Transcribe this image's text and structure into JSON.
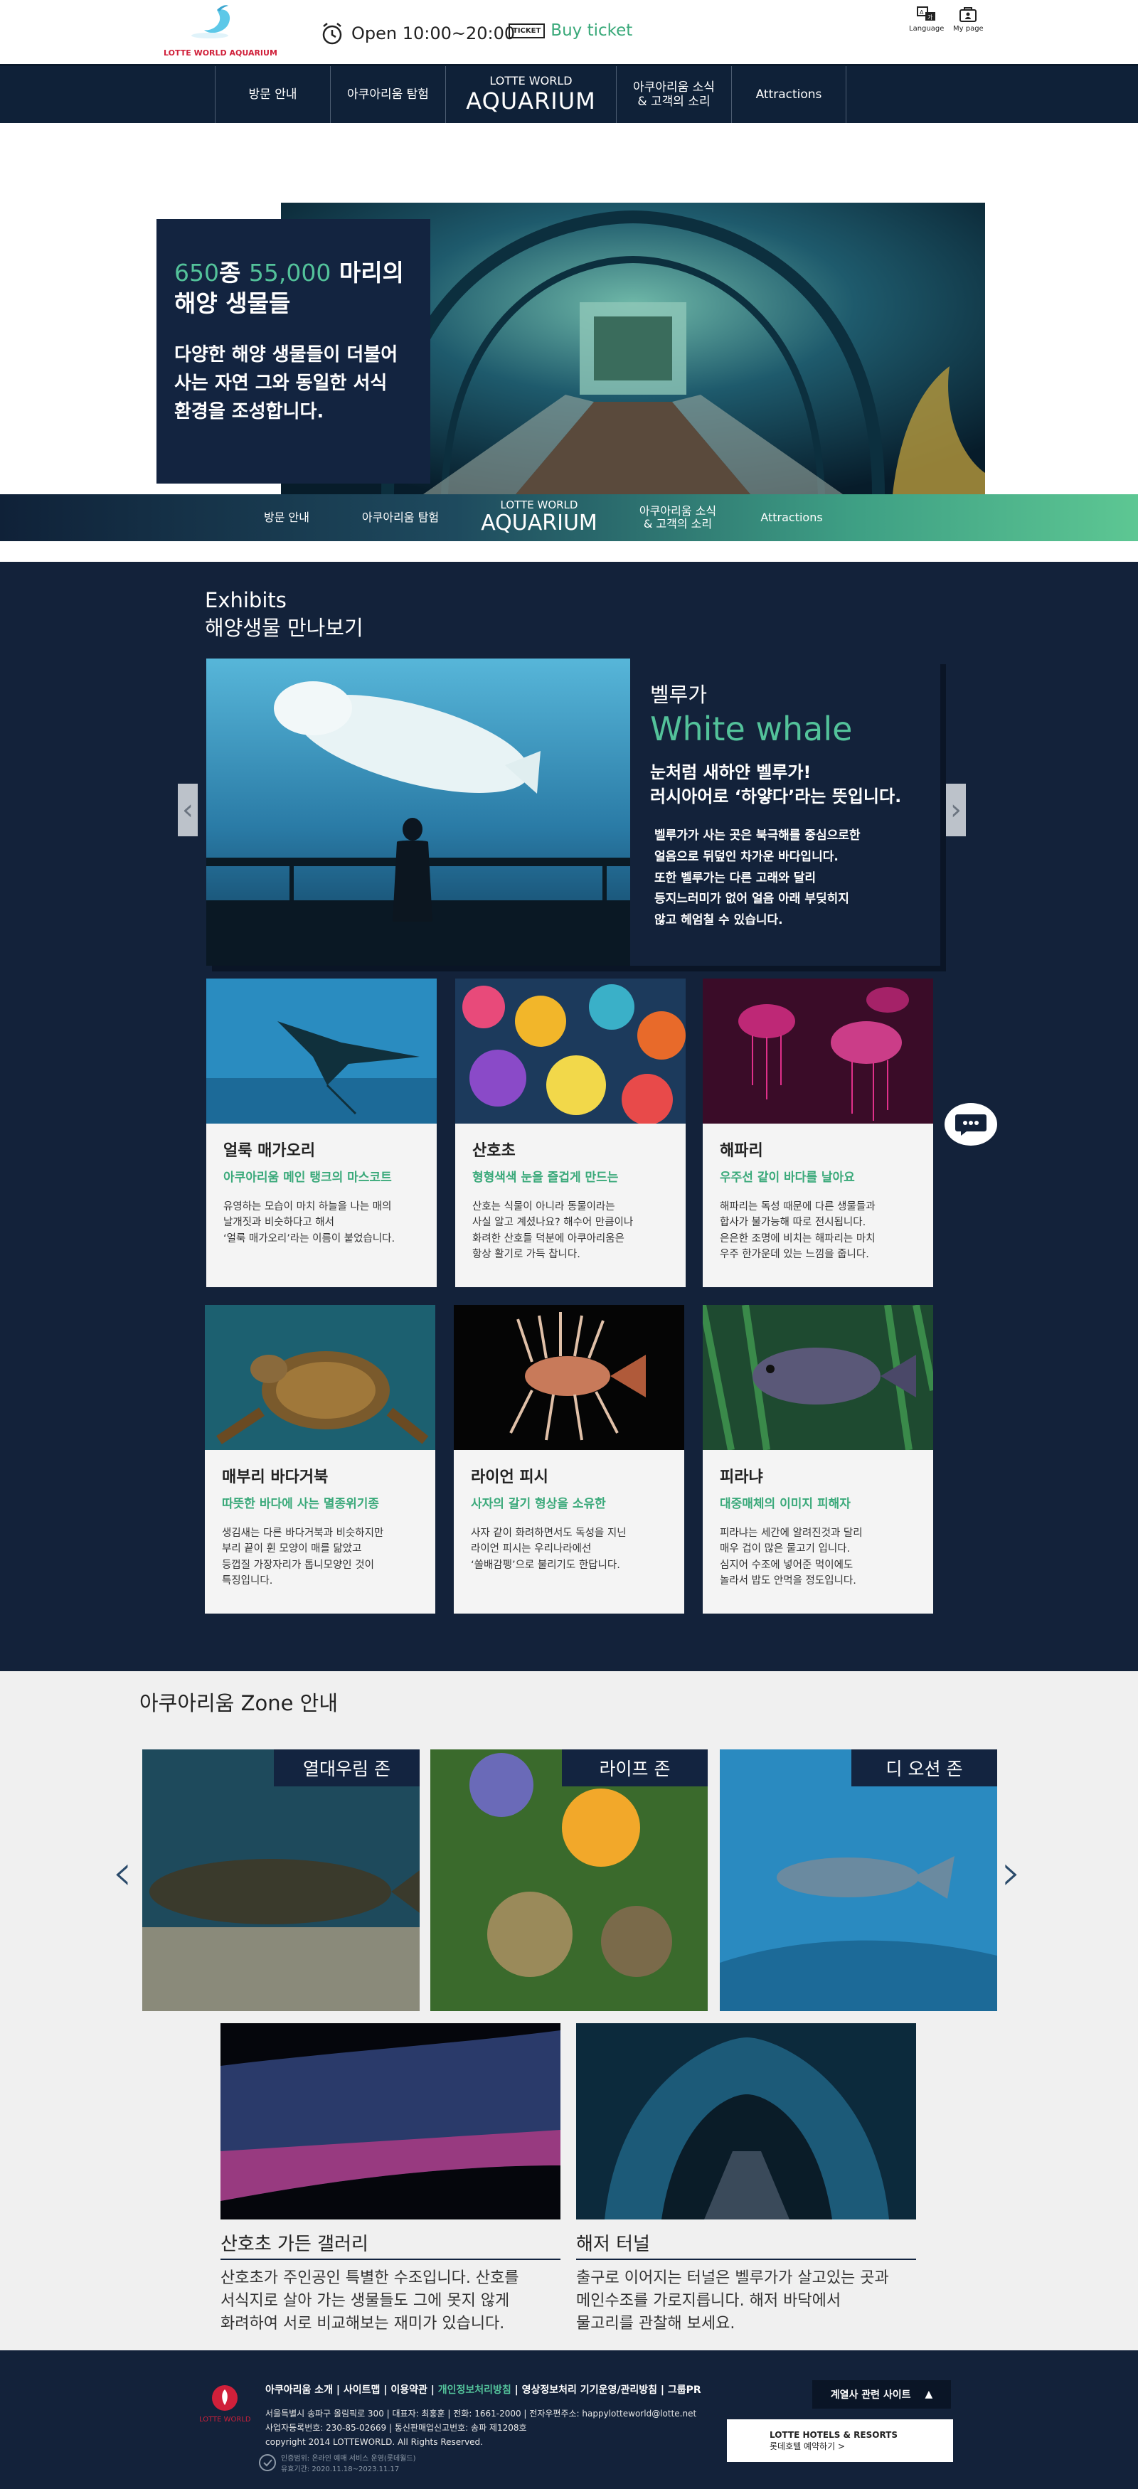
{
  "header": {
    "logo_text": "LOTTE WORLD AQUARIUM",
    "open_hours": "Open 10:00~20:00",
    "ticket_badge": "TICKET",
    "buy_ticket": "Buy ticket",
    "language": "Language",
    "my_page": "My page"
  },
  "nav": {
    "items": [
      "방문 안내",
      "아쿠아리움 탐험",
      "아쿠아리움 소식\n& 고객의 소리",
      "Attractions"
    ],
    "brand_top": "LOTTE WORLD",
    "brand_bottom": "AQUARIUM"
  },
  "hero": {
    "count_species": "650",
    "species_word": "종",
    "count_animals": "55,000",
    "animals_word": " 마리의",
    "title_line2": "해양 생물들",
    "body": "다양한 해양 생물들이 더불어\n사는 자연 그와 동일한 서식\n환경을 조성합니다."
  },
  "exhibits": {
    "title_en": "Exhibits",
    "title_ko": "해양생물 만나보기",
    "featured": {
      "name_ko": "벨루가",
      "name_en": "White whale",
      "subtitle": "눈처럼 새하얀 벨루가!\n러시아어로 ‘하얗다’라는 뜻입니다.",
      "desc": " 벨루가가 사는 곳은 북극해를 중심으로한\n얼음으로 뒤덮인 차가운 바다입니다.\n또한 벨루가는 다른 고래와 달리\n등지느러미가 없어 얼음 아래 부딪히지\n않고 헤엄칠 수 있습니다."
    },
    "cards": [
      {
        "title": "얼룩 매가오리",
        "sub": "아쿠아리움 메인 탱크의 마스코트",
        "desc": "유영하는 모습이 마치 하늘을 나는 매의\n날개짓과 비슷하다고 해서\n‘얼룩 매가오리’라는 이름이 붙었습니다."
      },
      {
        "title": "산호초",
        "sub": "형형색색 눈을 즐겁게 만드는",
        "desc": "산호는 식물이 아니라 동물이라는\n사실 알고 계셨나요? 해수어 만큼이나\n화려한 산호들 덕분에 아쿠아리움은\n항상 활기로 가득 찹니다."
      },
      {
        "title": "해파리",
        "sub": "우주선 같이 바다를 날아요",
        "desc": "해파리는 독성 때문에 다른 생물들과\n합사가 불가능해 따로 전시됩니다.\n은은한 조명에 비치는 해파리는 마치\n우주 한가운데 있는 느낌을 줍니다."
      },
      {
        "title": "매부리 바다거북",
        "sub": "따뜻한 바다에 사는 멸종위기종",
        "desc": "생김새는 다른 바다거북과 비슷하지만\n부리 끝이 휜 모양이 매를 닮았고\n등껍질 가장자리가 톱니모양인 것이\n특징입니다."
      },
      {
        "title": "라이언 피시",
        "sub": "사자의 갈기 형상을 소유한",
        "desc": "사자 같이 화려하면서도 독성을 지닌\n라이언 피시는 우리나라에선\n‘쏠배감펭’으로 불리기도 한답니다."
      },
      {
        "title": "피라냐",
        "sub": "대중매체의 이미지 피해자",
        "desc": "피라냐는 세간에 알려진것과 달리\n매우 겁이 많은 물고기 입니다.\n심지어 수조에 넣어준 먹이에도\n놀라서 밥도 안먹을 정도입니다."
      }
    ]
  },
  "zones": {
    "title": "아쿠아리움 Zone 안내",
    "top": [
      "열대우림 존",
      "라이프 존",
      "디 오션 존"
    ],
    "bottom": [
      {
        "title": "산호초 가든 갤러리",
        "desc": "산호초가 주인공인 특별한 수조입니다. 산호를\n서식지로 살아 가는 생물들도 그에 못지 않게\n화려하여 서로 비교해보는 재미가 있습니다."
      },
      {
        "title": "해저 터널",
        "desc": "출구로 이어지는 터널은 벨루가가 살고있는 곳과\n메인수조를 가로지릅니다. 해저 바닥에서\n물고리를 관찰해 보세요."
      }
    ]
  },
  "footer": {
    "logo_text": "LOTTE WORLD",
    "links": [
      "아쿠아리움 소개",
      "사이트맵",
      "이용약관",
      "개인정보처리방침",
      "영상정보처리 기기운영/관리방침",
      "그룹PR"
    ],
    "info1": "서울특별시 송파구 올림픽로 300 | 대표자: 최홍훈 | 전화: 1661-2000 | 전자우편주소: happylotteworld@lotte.net",
    "info2": "사업자등록번호: 230-85-02669 | 통신판매업신고번호: 송파 제1208호",
    "copyright": "copyright 2014 LOTTEWORLD. All Rights Reserved.",
    "cert1": "인증범위: 온라인 예매 서비스 운영(롯데월드)",
    "cert2": "유효기간: 2020.11.18~2023.11.17",
    "family_select": "계열사 관련 사이트",
    "hotel_line1": "LOTTE HOTELS & RESORTS",
    "hotel_line2": "롯데호텔 예약하기 >"
  },
  "colors": {
    "navy": "#13223a",
    "accent": "#53c29a",
    "brand_red": "#d0203a"
  }
}
